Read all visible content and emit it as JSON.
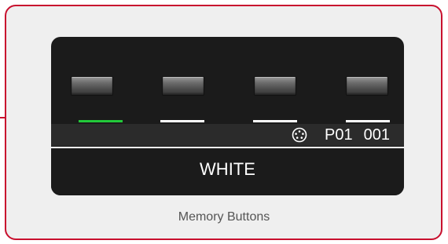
{
  "memory_buttons": [
    {
      "name": "memory-button-1",
      "indicator_active": true
    },
    {
      "name": "memory-button-2",
      "indicator_active": false
    },
    {
      "name": "memory-button-3",
      "indicator_active": false
    },
    {
      "name": "memory-button-4",
      "indicator_active": false
    }
  ],
  "display": {
    "status_icon": "midi-connector-icon",
    "patch_bank": "P01",
    "patch_number": "001",
    "patch_name": "WHITE"
  },
  "caption": "Memory Buttons",
  "colors": {
    "frame_border": "#c8102e",
    "frame_background": "#efefef",
    "device_background": "#1b1b1b",
    "active_indicator": "#22c93a",
    "inactive_indicator": "#ffffff",
    "text": "#ffffff",
    "caption_text": "#555555"
  }
}
